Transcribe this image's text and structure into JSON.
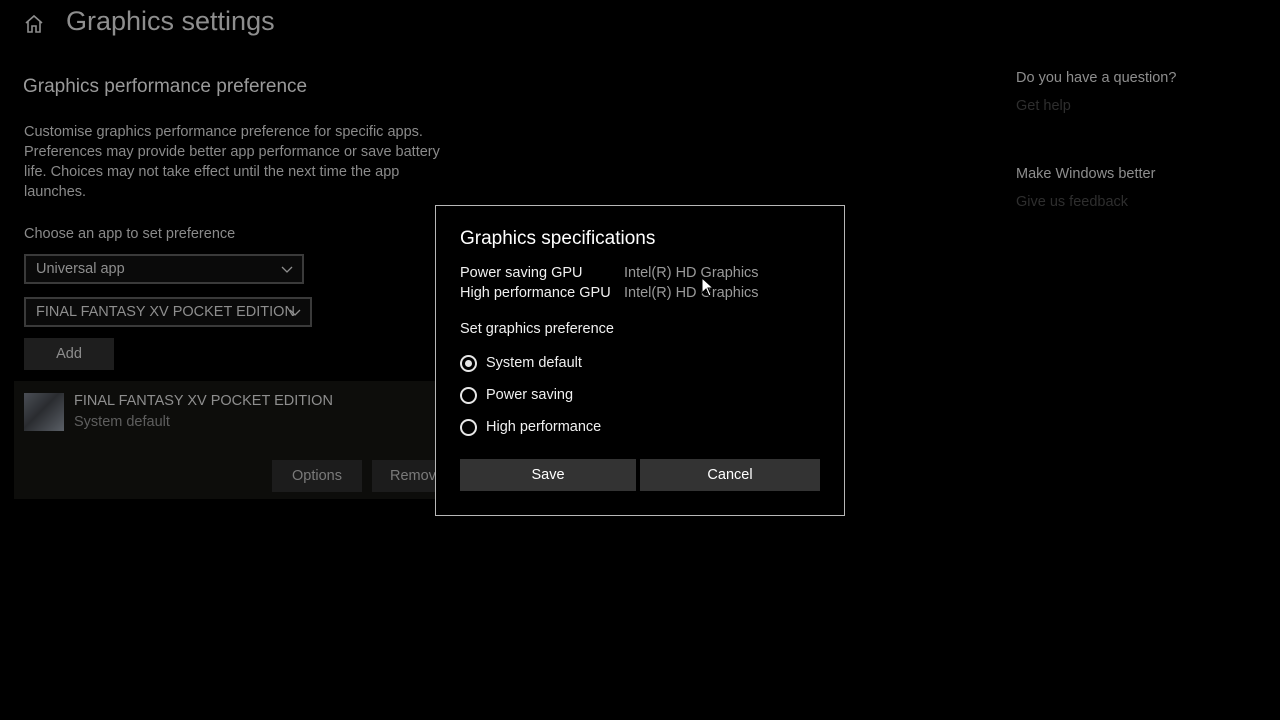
{
  "header": {
    "title": "Graphics settings",
    "home_icon": "home-icon"
  },
  "main": {
    "section_title": "Graphics performance preference",
    "description": "Customise graphics performance preference for specific apps. Preferences may provide better app performance or save battery life. Choices may not take effect until the next time the app launches.",
    "choose_label": "Choose an app to set preference",
    "app_type_select": "Universal app",
    "app_select": "FINAL FANTASY XV POCKET EDITION",
    "add_label": "Add",
    "app_list": [
      {
        "name": "FINAL FANTASY XV POCKET EDITION",
        "preference": "System default",
        "options_label": "Options",
        "remove_label": "Remove"
      }
    ]
  },
  "aside": {
    "question_title": "Do you have a question?",
    "help_link": "Get help",
    "feedback_title": "Make Windows better",
    "feedback_link": "Give us feedback"
  },
  "dialog": {
    "title": "Graphics specifications",
    "specs": [
      {
        "label": "Power saving GPU",
        "value": "Intel(R) HD Graphics"
      },
      {
        "label": "High performance GPU",
        "value": "Intel(R) HD Graphics"
      }
    ],
    "pref_label": "Set graphics preference",
    "options": [
      {
        "label": "System default",
        "checked": true
      },
      {
        "label": "Power saving",
        "checked": false
      },
      {
        "label": "High performance",
        "checked": false
      }
    ],
    "save_label": "Save",
    "cancel_label": "Cancel"
  },
  "colors": {
    "background": "#000000",
    "dialog_border": "#b7b7b7",
    "button": "#333333"
  }
}
